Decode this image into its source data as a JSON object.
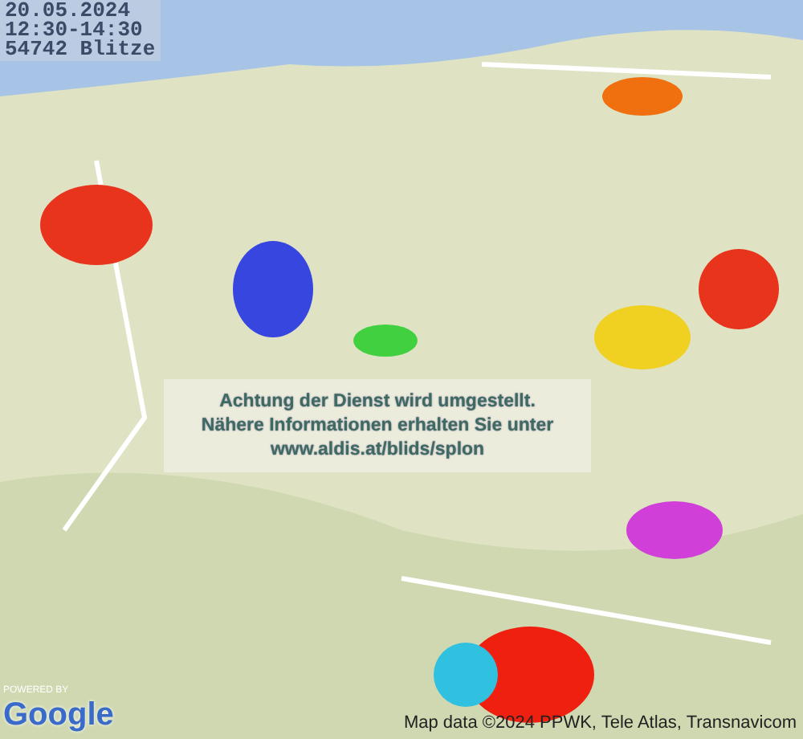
{
  "info_box": {
    "lines": [
      "20.05.2024",
      "12:30-14:30",
      "54742 Blitze"
    ]
  },
  "notice": {
    "lines": [
      "Achtung der Dienst wird umgestellt.",
      "Nähere Informationen erhalten Sie unter",
      "www.aldis.at/blids/splon"
    ]
  },
  "logo": {
    "powered_by": "POWERED BY",
    "name": "Google"
  },
  "attribution": "Map data ©2024 PPWK, Tele Atlas, Transnavicom"
}
